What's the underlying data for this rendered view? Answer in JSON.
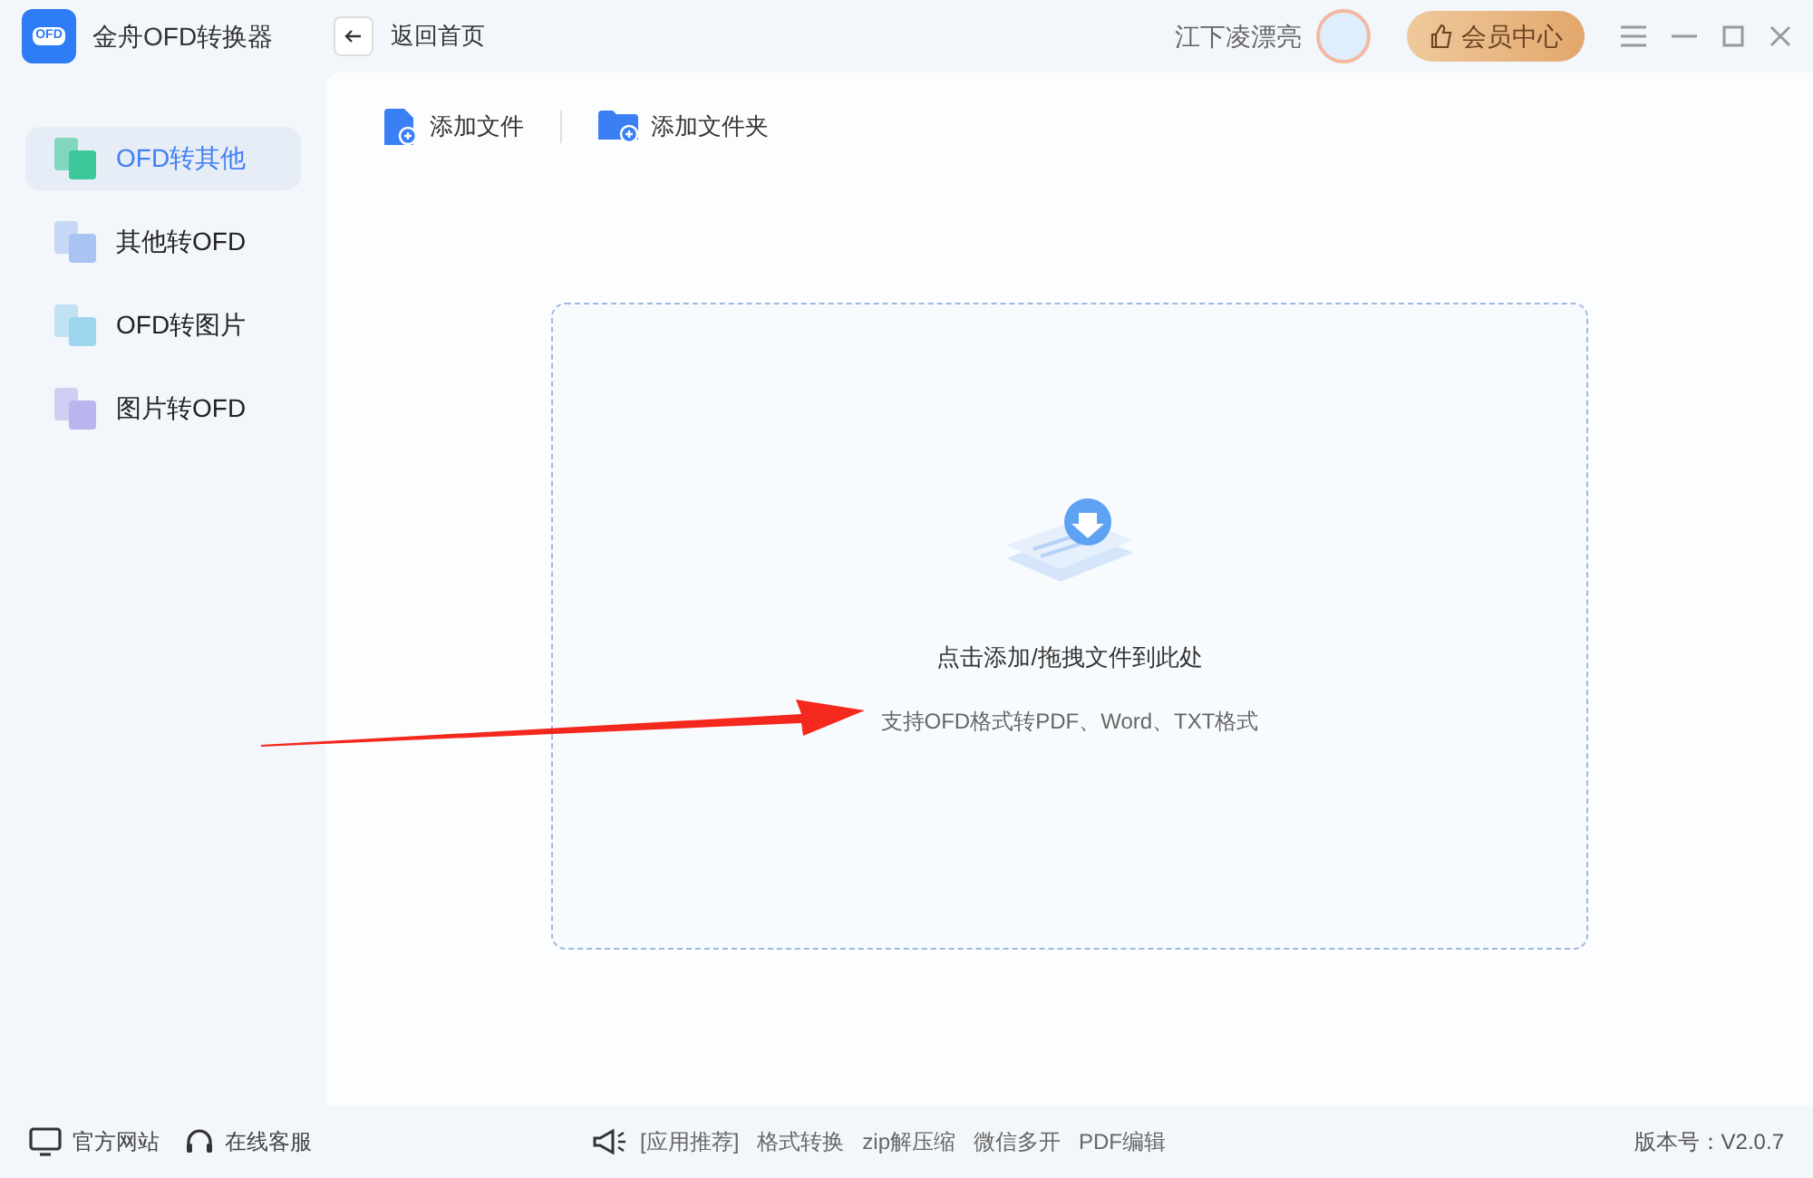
{
  "app": {
    "title": "金舟OFD转换器",
    "logo_text": "OFD"
  },
  "header": {
    "back_label": "返回首页",
    "username": "江下凌漂亮",
    "vip_button": "会员中心"
  },
  "sidebar": {
    "items": [
      {
        "label": "OFD转其他",
        "selected": true,
        "color": "#3cc89a"
      },
      {
        "label": "其他转OFD",
        "selected": false,
        "color": "#a9c4f2"
      },
      {
        "label": "OFD转图片",
        "selected": false,
        "color": "#9ed6ef"
      },
      {
        "label": "图片转OFD",
        "selected": false,
        "color": "#b9b5ee"
      }
    ]
  },
  "toolbar": [
    {
      "kind": "file",
      "label": "添加文件"
    },
    {
      "kind": "folder",
      "label": "添加文件夹"
    }
  ],
  "dropzone": {
    "title": "点击添加/拖拽文件到此处",
    "subtitle": "支持OFD格式转PDF、Word、TXT格式"
  },
  "footer": {
    "links": [
      {
        "kind": "website",
        "label": "官方网站"
      },
      {
        "kind": "support",
        "label": "在线客服"
      }
    ],
    "recommend_label": "[应用推荐]",
    "recommend": [
      "格式转换",
      "zip解压缩",
      "微信多开",
      "PDF编辑"
    ],
    "version": "版本号：V2.0.7"
  }
}
